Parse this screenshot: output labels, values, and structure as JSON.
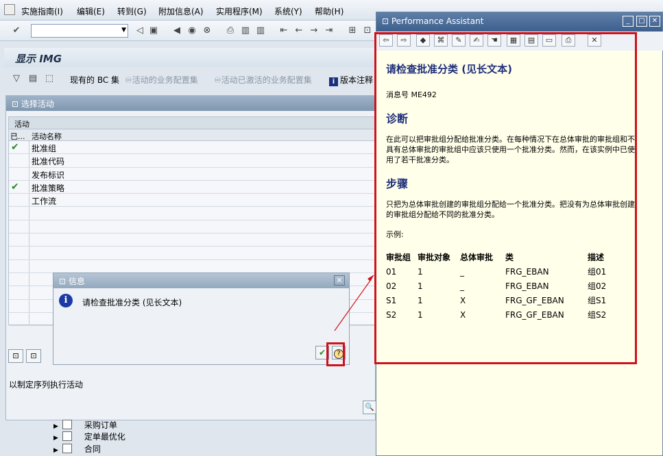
{
  "menubar": {
    "items": [
      "实施指南(I)",
      "编辑(E)",
      "转到(G)",
      "附加信息(A)",
      "实用程序(M)",
      "系统(Y)",
      "帮助(H)"
    ]
  },
  "main": {
    "title": "显示 IMG",
    "appbar": {
      "bc_set": "现有的 BC 集",
      "active_bc": "活动的业务配置集",
      "activated_bc": "活动已激活的业务配置集",
      "version_note": "版本注释"
    },
    "panel": {
      "title": "选择活动",
      "table_caption": "活动",
      "col_done": "已...",
      "col_name": "活动名称",
      "rows": [
        {
          "name": "批准组",
          "done": true
        },
        {
          "name": "批准代码",
          "done": false
        },
        {
          "name": "发布标识",
          "done": false
        },
        {
          "name": "批准策略",
          "done": true
        },
        {
          "name": "工作流",
          "done": false
        }
      ],
      "seq_text": "以制定序列执行活动"
    },
    "tree": [
      "采购订单",
      "定单最优化",
      "合同"
    ]
  },
  "dialog": {
    "title": "信息",
    "message": "请检查批准分类 (见长文本)"
  },
  "pa": {
    "title": "Performance Assistant",
    "heading": "请检查批准分类 (见长文本)",
    "msg_no": "消息号  ME492",
    "diag_title": "诊断",
    "diag_text": "在此可以把审批组分配给批准分类。在每种情况下在总体审批的审批组和不具有总体审批的审批组中应该只使用一个批准分类。然而，在该实例中已使用了若干批准分类。",
    "steps_title": "步骤",
    "steps_text": "只把为总体审批创建的审批组分配给一个批准分类。把没有为总体审批创建的审批组分配给不同的批准分类。",
    "example_label": "示例:",
    "table": {
      "headers": [
        "审批组",
        "审批对象",
        "总体审批",
        "类",
        "描述"
      ],
      "rows": [
        [
          "01",
          "1",
          "_",
          "FRG_EBAN",
          "组01"
        ],
        [
          "02",
          "1",
          "_",
          "FRG_EBAN",
          "组02"
        ],
        [
          "S1",
          "1",
          "X",
          "FRG_GF_EBAN",
          "组S1"
        ],
        [
          "S2",
          "1",
          "X",
          "FRG_GF_EBAN",
          "组S2"
        ]
      ]
    }
  }
}
